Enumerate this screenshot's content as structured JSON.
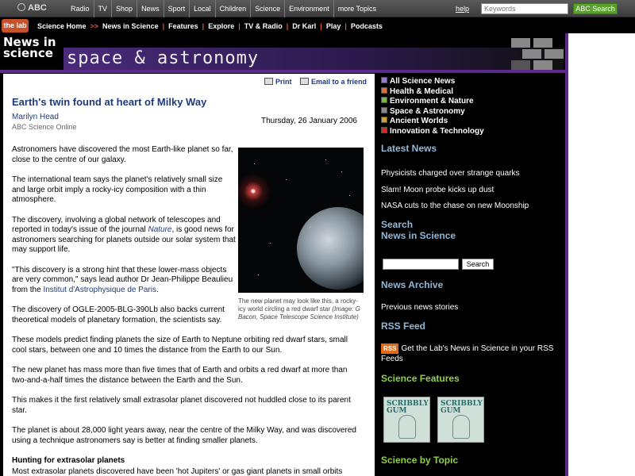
{
  "abc_bar": {
    "logo": "ABC",
    "nav": [
      "Radio",
      "TV",
      "Shop",
      "News",
      "Sport",
      "Local",
      "Children",
      "Science",
      "Environment",
      "more Topics"
    ],
    "help": "help",
    "search_placeholder": "Keywords",
    "search_button": "ABC Search"
  },
  "lab_bar": {
    "logo": "the lab",
    "items": [
      "Science Home",
      "News in Science",
      "Features",
      "Explore",
      "TV & Radio",
      "Dr Karl",
      "Play",
      "Podcasts"
    ]
  },
  "banner": {
    "section": "News in science",
    "title": "space & astronomy"
  },
  "article": {
    "print": "Print",
    "email": "Email to a friend",
    "title": "Earth's twin found at heart of Milky Way",
    "author": "Marilyn Head",
    "source": "ABC Science Online",
    "date": "Thursday, 26 January 2006",
    "p1": "Astronomers have discovered the most Earth-like planet so far, close to the centre of our galaxy.",
    "p2": "The international team says the planet's relatively small size and large orbit imply a rocky-icy composition with a thin atmosphere.",
    "p3_a": "The discovery, involving a global network of telescopes and reported in today's issue of the journal ",
    "p3_journal": "Nature",
    "p3_b": ", is good news for astronomers searching for planets outside our solar system that may support life.",
    "p4_a": "\"This discovery is a strong hint that these lower-mass objects are very common,\" says lead author Dr Jean-Philippe Beaulieu from the ",
    "p4_inst": "Institut d'Astrophysique de Paris",
    "p4_b": ".",
    "p5": "The discovery of OGLE-2005-BLG-390Lb also backs current theoretical models of planetary formation, the scientists say.",
    "p6": "These models predict finding planets the size of Earth to Neptune orbiting red dwarf stars, small cool stars, between one and 10 times the distance from the Earth to our Sun.",
    "p7": "The new planet has mass more than five times that of Earth and orbits a red dwarf at more than two-and-a-half times the distance between the Earth and the Sun.",
    "p8": "This makes it the first relatively small extrasolar planet discovered not huddled close to its parent star.",
    "p9": "The planet is about 28,000 light years away, near the centre of the Milky Way, and was discovered using a technique astronomers say is better at finding smaller planets.",
    "subhead": "Hunting for extrasolar planets",
    "p10": "Most extrasolar planets discovered have been 'hot Jupiters' or gas giant planets in small orbits",
    "caption": "The new planet may look like this, a rocky-icy world circling a red dwarf star",
    "caption_credit": "(Image: G Bacon, Space Telescope Science Institute)"
  },
  "sidebar": {
    "categories": [
      {
        "label": "All Science News",
        "color": "#9a7ad0"
      },
      {
        "label": "Health & Medical",
        "color": "#e0703a"
      },
      {
        "label": "Environment & Nature",
        "color": "#7ab84a"
      },
      {
        "label": "Space & Astronomy",
        "color": "#8a8a8a"
      },
      {
        "label": "Ancient Worlds",
        "color": "#d0a030"
      },
      {
        "label": "Innovation & Technology",
        "color": "#d02a2a"
      }
    ],
    "latest_title": "Latest News",
    "latest": [
      "Physicists charged over strange quarks",
      "Slam! Moon probe kicks up dust",
      "NASA cuts to the chase on new Moonship"
    ],
    "search_title_1": "Search",
    "search_title_2": "News in Science",
    "search_button": "Search",
    "archive_title": "News Archive",
    "archive_link": "Previous news stories",
    "rss_title": "RSS Feed",
    "rss_badge": "RSS",
    "rss_text": "Get the Lab's News in Science in your RSS Feeds",
    "features_title": "Science Features",
    "feature_label": "SCRIBBLY GUM",
    "topic_title": "Science by Topic"
  }
}
